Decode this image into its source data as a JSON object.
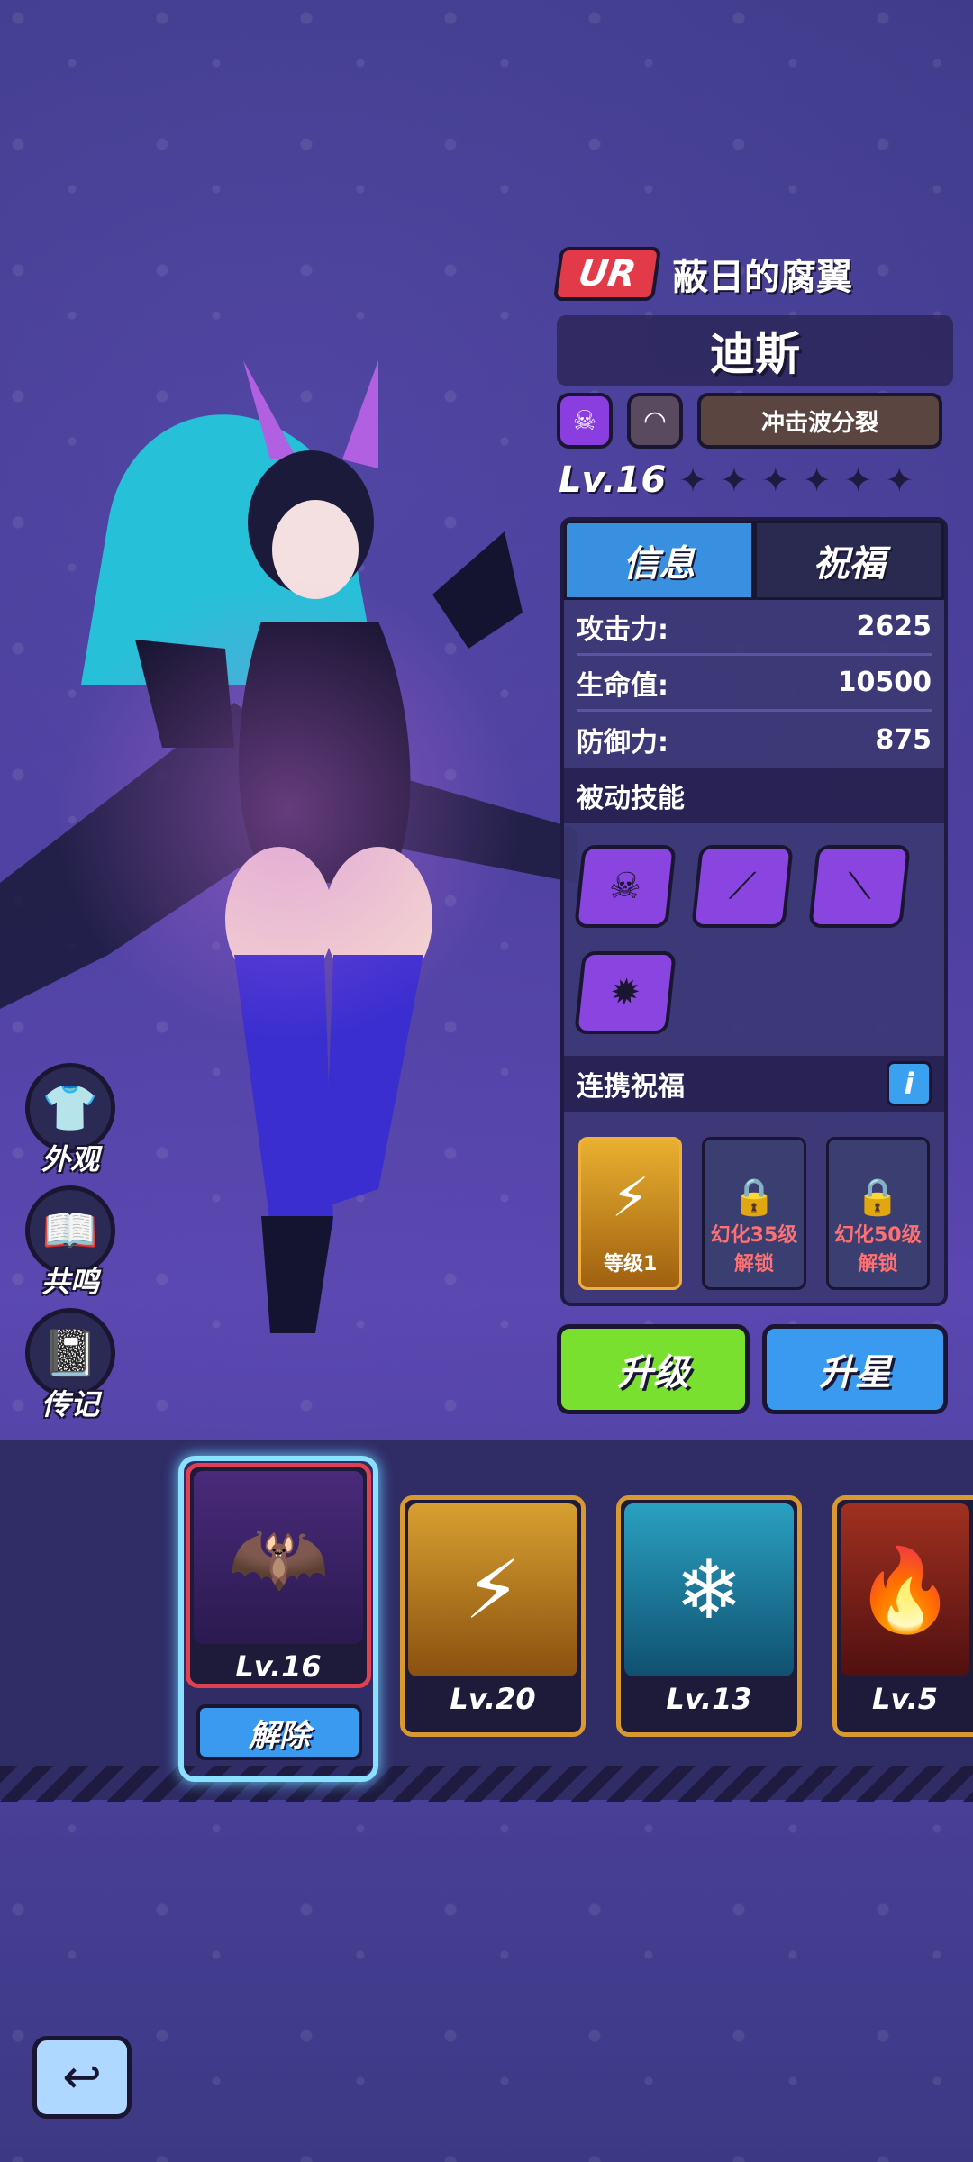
{
  "hero": {
    "rarity": "UR",
    "skin_name": "蔽日的腐翼",
    "name": "迪斯",
    "skill_tag": "冲击波分裂",
    "level": "Lv.16",
    "stars_total": 6,
    "stars_filled": 0
  },
  "tabs": {
    "info": "信息",
    "blessing": "祝福"
  },
  "stats": [
    {
      "label": "攻击力:",
      "value": "2625"
    },
    {
      "label": "生命值:",
      "value": "10500"
    },
    {
      "label": "防御力:",
      "value": "875"
    }
  ],
  "passive_title": "被动技能",
  "passive_icons": [
    "cards-skull-icon",
    "wing-icon",
    "wing-claw-icon",
    "explosion-skull-icon"
  ],
  "link_bless": {
    "title": "连携祝福",
    "info_label": "i",
    "slots": [
      {
        "label": "等级1",
        "locked": false
      },
      {
        "label": "幻化35级\n解锁",
        "locked": true,
        "line1": "幻化35级",
        "line2": "解锁"
      },
      {
        "label": "幻化50级\n解锁",
        "locked": true,
        "line1": "幻化50级",
        "line2": "解锁"
      }
    ]
  },
  "buttons": {
    "upgrade": "升级",
    "star_up": "升星",
    "remove": "解除"
  },
  "side_menu": {
    "appearance": "外观",
    "resonance": "共鸣",
    "biography": "传记"
  },
  "cards": [
    {
      "level": "Lv.16"
    },
    {
      "level": "Lv.20"
    },
    {
      "level": "Lv.13"
    },
    {
      "level": "Lv.5"
    }
  ],
  "colors": {
    "accent_blue": "#3a9af0",
    "upgrade_green": "#7ae030",
    "rarity_red": "#e23a48"
  }
}
